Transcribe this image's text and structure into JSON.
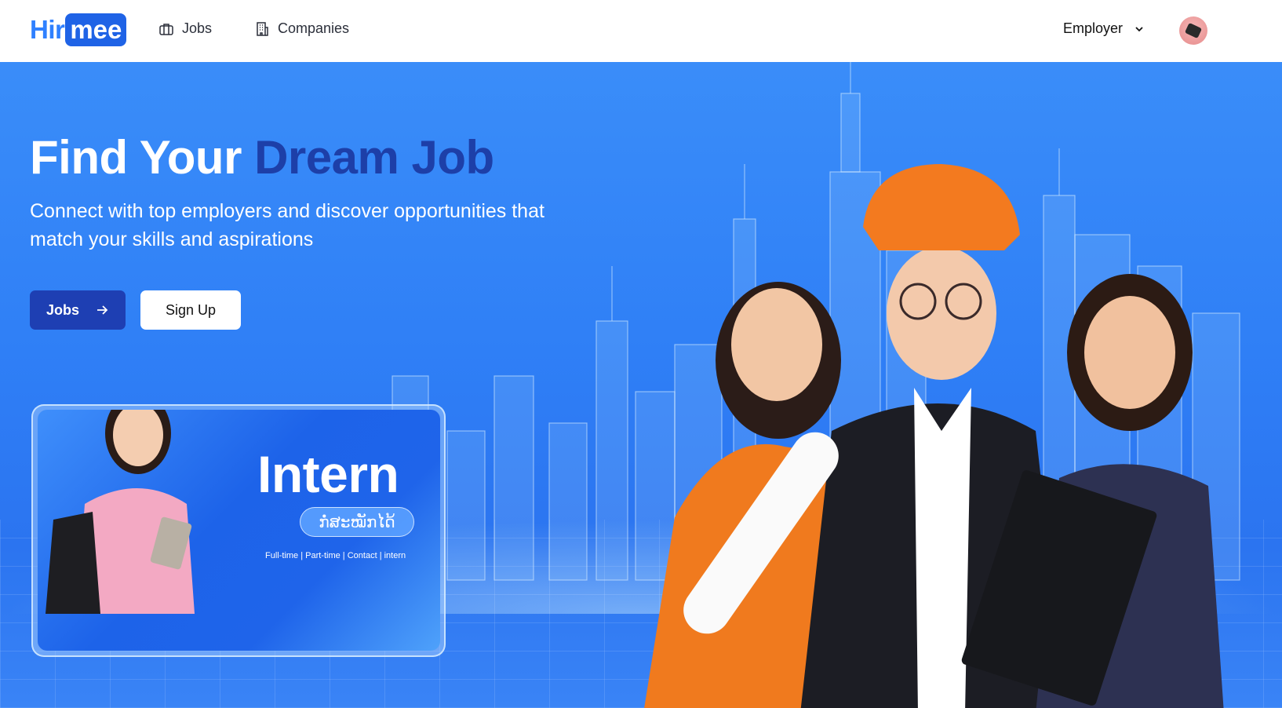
{
  "brand": {
    "logo_part1": "Hir",
    "logo_part2": "mee"
  },
  "nav": {
    "jobs_label": "Jobs",
    "companies_label": "Companies",
    "employer_label": "Employer"
  },
  "hero": {
    "title_main": "Find Your ",
    "title_accent": "Dream Job",
    "subtitle": "Connect with top employers and discover opportunities that match your skills and aspirations",
    "jobs_button": "Jobs",
    "signup_button": "Sign Up"
  },
  "banner": {
    "title": "Intern",
    "pill_text": "ກໍ່ສະໝັກໄດ້",
    "tags": "Full-time | Part-time | Contact | intern"
  },
  "colors": {
    "brand_blue": "#1f63e6",
    "hero_bg": "#2f7ff6",
    "title_accent": "#1d3fa8",
    "primary_button": "#1e3fb3"
  },
  "icons": {
    "jobs": "briefcase-icon",
    "companies": "building-icon",
    "employer_dropdown": "chevron-down-icon",
    "jobs_button": "arrow-right-icon"
  }
}
